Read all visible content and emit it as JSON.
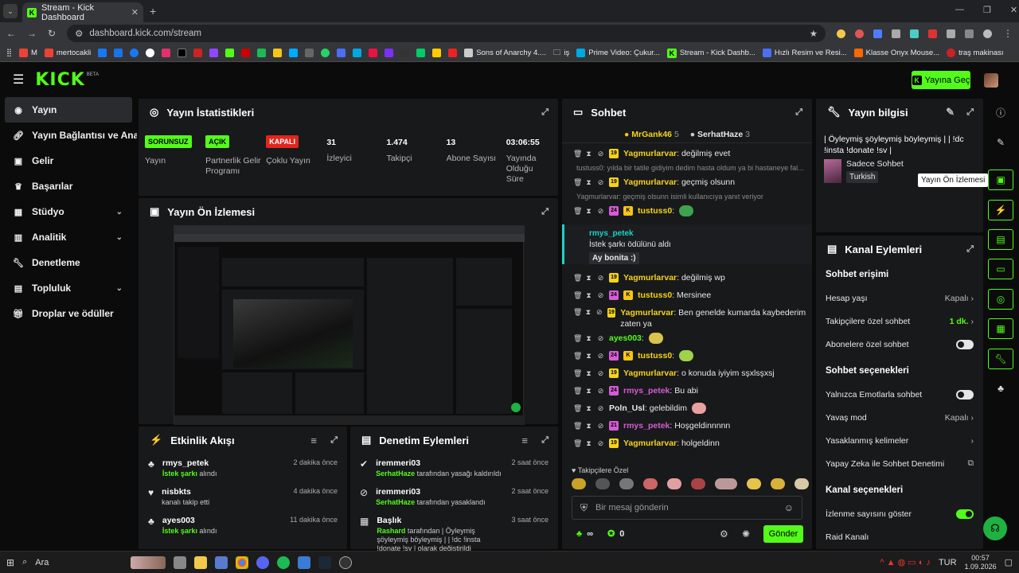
{
  "browser": {
    "tab_title": "Stream - Kick Dashboard",
    "url": "dashboard.kick.com/stream",
    "bookmarks": [
      "mertocakli",
      "Sons of Anarchy 4....",
      "iş",
      "Prime Video: Çukur...",
      "Stream - Kick Dashb...",
      "Hızlı Resim ve Resi...",
      "Klasse Onyx Mouse...",
      "traş makinası"
    ]
  },
  "header": {
    "logo": "KICK",
    "beta": "BETA",
    "go_live": "Yayına Geç"
  },
  "sidebar": {
    "items": [
      {
        "label": "Yayın"
      },
      {
        "label": "Yayın Bağlantısı ve Anahtar"
      },
      {
        "label": "Gelir"
      },
      {
        "label": "Başarılar"
      },
      {
        "label": "Stüdyo"
      },
      {
        "label": "Analitik"
      },
      {
        "label": "Denetleme"
      },
      {
        "label": "Topluluk"
      },
      {
        "label": "Droplar ve ödüller"
      }
    ]
  },
  "stats": {
    "title": "Yayın İstatistikleri",
    "items": [
      {
        "value": "SORUNSUZ",
        "label": "Yayın",
        "color": "#53fc18"
      },
      {
        "value": "AÇIK",
        "label": "Partnerlik Gelir Programı",
        "color": "#53fc18"
      },
      {
        "value": "KAPALI",
        "label": "Çoklu Yayın",
        "color": "#e0261e"
      },
      {
        "value": "31",
        "label": "İzleyici"
      },
      {
        "value": "1.474",
        "label": "Takipçi"
      },
      {
        "value": "13",
        "label": "Abone Sayısı"
      },
      {
        "value": "03:06:55",
        "label": "Yayında Olduğu Süre"
      }
    ]
  },
  "preview": {
    "title": "Yayın Ön İzlemesi"
  },
  "activity": {
    "title": "Etkinlik Akışı",
    "items": [
      {
        "name": "rmys_petek",
        "hl": "İstek şarkı",
        "rest": " alındı",
        "time": "2 dakika önce"
      },
      {
        "name": "nisbkts",
        "hl": "",
        "rest": "kanalı takip etti",
        "time": "4 dakika önce"
      },
      {
        "name": "ayes003",
        "hl": "İstek şarkı",
        "rest": " alındı",
        "time": "11 dakika önce"
      }
    ]
  },
  "moderation": {
    "title": "Denetim Eylemleri",
    "items": [
      {
        "name": "iremmeri03",
        "hl": "SerhatHaze",
        "rest": " tarafından yasağı kaldırıldı",
        "time": "2 saat önce"
      },
      {
        "name": "iremmeri03",
        "hl": "SerhatHaze",
        "rest": " tarafından yasaklandı",
        "time": "2 saat önce"
      },
      {
        "name": "Başlık",
        "hl": "Rashard",
        "rest": " tarafından | Öyleymiş şöyleymiş böyleymiş | | !dc !insta !donate !sv | olarak değiştirildi",
        "time": "3 saat önce"
      }
    ]
  },
  "chat": {
    "title": "Sohbet",
    "top_gifters": [
      {
        "name": "MrGank46",
        "count": "5"
      },
      {
        "name": "SerhatHaze",
        "count": "3"
      }
    ],
    "messages": [
      {
        "user": "Yagmurlarvar",
        "color": "y",
        "text": ": değilmiş evet"
      },
      {
        "reply": "tustuss0: yılda bir tatile gidiyim dedim hasta oldum ya bi hastaneye fal..."
      },
      {
        "user": "Yagmurlarvar",
        "color": "y",
        "text": ": geçmiş olsunn"
      },
      {
        "reply": "Yagmurlarvar: geçmiş olsunn isimli kullanıcıya yanıt veriyor"
      },
      {
        "user": "tustuss0",
        "color": "y",
        "text": ":"
      },
      {
        "user": "Yagmurlarvar",
        "color": "y",
        "text": ": değilmiş wp"
      },
      {
        "user": "tustuss0",
        "color": "y",
        "text": ": Mersinee"
      },
      {
        "user": "Yagmurlarvar",
        "color": "y",
        "text": ": Ben genelde kumarda kaybederim zaten ya"
      },
      {
        "user": "ayes003",
        "color": "g",
        "text": ":"
      },
      {
        "user": "tustuss0",
        "color": "y",
        "text": ":"
      },
      {
        "user": "Yagmurlarvar",
        "color": "y",
        "text": ": o konuda iyiyim sşxlsşxsj"
      },
      {
        "user": "rmys_petek",
        "color": "p",
        "text": ": Bu abi"
      },
      {
        "user": "Poln_Usl",
        "color": "w",
        "text": ": gelebildim"
      },
      {
        "user": "rmys_petek",
        "color": "p",
        "text": ": Hoşgeldinnnnn"
      },
      {
        "user": "Yagmurlarvar",
        "color": "y",
        "text": ": holgeldinn"
      }
    ],
    "highlight": {
      "user": "rmys_petek",
      "line": "İstek şarkı ödülünü aldı",
      "song": "Ay bonita :)"
    },
    "followers_only": "Takipçilere Özel",
    "input_placeholder": "Bir mesaj gönderin",
    "infinity": "∞",
    "points": "0",
    "send": "Gönder"
  },
  "stream_info": {
    "title": "Yayın bilgisi",
    "stream_title": "| Öyleymiş şöyleymiş böyleymiş | | !dc !insta !donate !sv |",
    "category": "Sadece Sohbet",
    "language": "Turkish",
    "tooltip": "Yayın Ön İzlemesi"
  },
  "channel_actions": {
    "title": "Kanal Eylemleri",
    "chat_access": "Sohbet erişimi",
    "account_age": "Hesap yaşı",
    "account_age_val": "Kapalı",
    "followers_chat": "Takipçilere özel sohbet",
    "followers_chat_val": "1 dk.",
    "subs_chat": "Abonelere özel sohbet",
    "chat_options": "Sohbet seçenekleri",
    "emote_only": "Yalnızca Emotlarla sohbet",
    "slow_mode": "Yavaş mod",
    "slow_mode_val": "Kapalı",
    "banned_words": "Yasaklanmış kelimeler",
    "ai_mod": "Yapay Zeka ile Sohbet Denetimi",
    "channel_options": "Kanal seçenekleri",
    "show_views": "İzlenme sayısını göster",
    "raid": "Raid Kanalı"
  },
  "taskbar": {
    "search": "Ara",
    "lang": "TUR",
    "time": "00:57",
    "date": "1.09.2026"
  },
  "colors": {
    "accent": "#53fc18",
    "panel": "#18191b",
    "bg": "#0b0b0c"
  }
}
